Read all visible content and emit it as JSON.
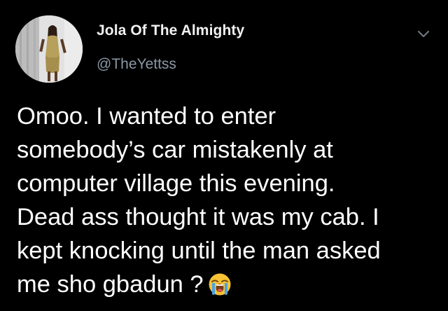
{
  "author": {
    "display_name": "Jola Of The Almighty",
    "handle": "@TheYettss",
    "avatar_icon": "profile-photo"
  },
  "menu": {
    "icon": "chevron-down-icon"
  },
  "tweet": {
    "lines": [
      "Omoo. I wanted to enter",
      "somebody’s car mistakenly at",
      "computer village this evening.",
      "Dead ass thought it was my cab. I",
      "kept knocking until the man asked",
      "me sho gbadun ?"
    ],
    "emoji": "loudly-crying-face-icon"
  },
  "colors": {
    "background": "#000000",
    "text": "#ffffff",
    "secondary_text": "#8b98a5",
    "chevron": "#6e767d"
  }
}
